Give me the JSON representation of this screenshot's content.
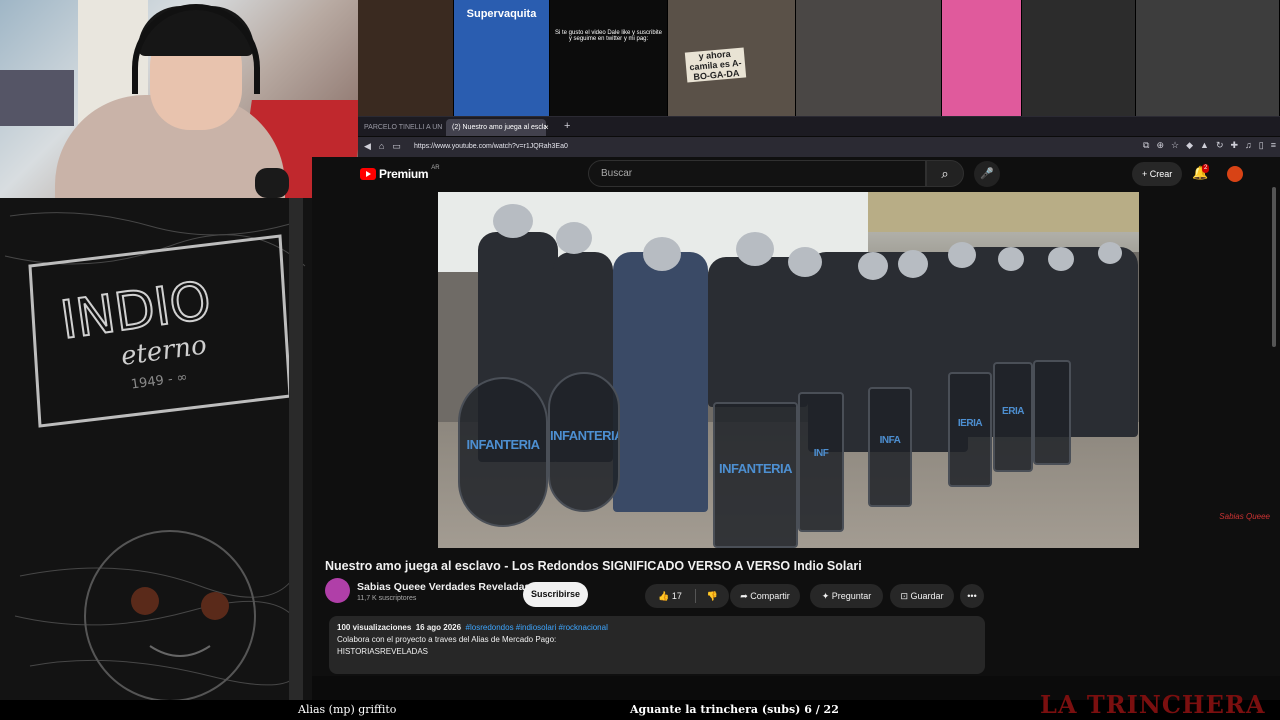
{
  "thumbnails": [
    {
      "label": "",
      "color": "#3a2a20"
    },
    {
      "label": "Supervaquita",
      "color": "#2a5db0"
    },
    {
      "label": "Si te gusto el video Dale like y suscribite y seguime en twitter y mi pag:",
      "color": "#0c0c0c"
    },
    {
      "label": "y ahora camila es A-BO-GA-DA",
      "color": "#5a5148"
    },
    {
      "label": "",
      "color": "#4a4745"
    },
    {
      "label": "",
      "color": "#e05a9c"
    },
    {
      "label": "",
      "color": "#2c2c2c"
    },
    {
      "label": "",
      "color": "#3d3d3d"
    }
  ],
  "browser": {
    "tab1_label": "PARCELO TINELLI A UN PROF",
    "tab2_label": "(2) Nuestro amo juega al escla",
    "tab_close": "×",
    "new_tab": "+",
    "url": "https://www.youtube.com/watch?v=r1JQRah3Ea0"
  },
  "youtube": {
    "logo_text": "Premium",
    "logo_country": "AR",
    "search_placeholder": "Buscar",
    "search_icon": "⌕",
    "mic_icon": "🎤",
    "create_label": "+ Crear",
    "notifications": "2",
    "video": {
      "shield_label": "INFANTERIA",
      "watermark": "Sabias Queee"
    },
    "title": "Nuestro amo juega al esclavo - Los Redondos SIGNIFICADO VERSO A VERSO Indio Solari",
    "channel": {
      "name": "Sabias Queee Verdades Reveladas",
      "subs": "11,7 K suscriptores"
    },
    "subscribe_label": "Suscribirse",
    "actions": {
      "likes": "👍 17",
      "dislike": "👎",
      "share": "➦ Compartir",
      "ask": "✦ Preguntar",
      "save": "⊡ Guardar",
      "more": "•••"
    },
    "description": {
      "views": "100 visualizaciones",
      "date": "16 ago 2026",
      "tags": "#losredondos #indiosolari #rocknacional",
      "line1": "Colabora con el proyecto a traves del Alias de Mercado Pago:",
      "line2": "HISTORIASREVELADAS"
    }
  },
  "overlay": {
    "alias": "Alias (mp) griffito",
    "song": "Aguante la trinchera (subs) 6 / 22",
    "brand": "LA TRINCHERA",
    "art_text": "INDIO",
    "art_sub": "eterno",
    "art_year": "1949 - ∞"
  }
}
